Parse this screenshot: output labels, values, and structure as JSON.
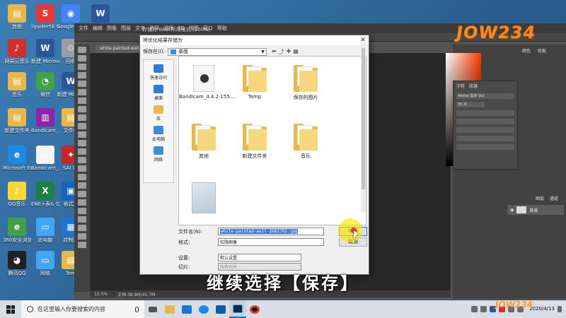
{
  "desktop_icons": [
    {
      "label": "其他",
      "color": "#e8b94a",
      "glyph": "▤"
    },
    {
      "label": "Spyder5E 5.2",
      "color": "#e53935",
      "glyph": "S"
    },
    {
      "label": "Google Chrome",
      "color": "#4285f4",
      "glyph": "◉"
    },
    {
      "label": "新建",
      "color": "#2b579a",
      "glyph": "W"
    },
    {
      "label": "网易云音乐",
      "color": "#d32f2f",
      "glyph": "♪"
    },
    {
      "label": "新建 Microsoft",
      "color": "#2b579a",
      "glyph": "W"
    },
    {
      "label": "回收",
      "color": "#9e9e9e",
      "glyph": "♲"
    },
    {
      "label": "音乐",
      "color": "#e8b94a",
      "glyph": "▤"
    },
    {
      "label": "微信",
      "color": "#43a047",
      "glyph": "◔"
    },
    {
      "label": "新建 Micros",
      "color": "#2b579a",
      "glyph": "W"
    },
    {
      "label": "新建文件夹",
      "color": "#e8b94a",
      "glyph": "▤"
    },
    {
      "label": "Bandicam_...",
      "color": "#8e24aa",
      "glyph": "▥"
    },
    {
      "label": "文件保",
      "color": "#e8b94a",
      "glyph": "▤"
    },
    {
      "label": "Microsoft Edge",
      "color": "#1e88e5",
      "glyph": "e"
    },
    {
      "label": "Bandicam_...",
      "color": "#f5f5f5",
      "glyph": "▭"
    },
    {
      "label": "SAI Vo",
      "color": "#c62828",
      "glyph": "✦"
    },
    {
      "label": "QQ音乐",
      "color": "#fdd835",
      "glyph": "♪"
    },
    {
      "label": "ENE+表& 位.xls",
      "color": "#1e7e45",
      "glyph": "X"
    },
    {
      "label": "格式工",
      "color": "#1565c0",
      "glyph": "▣"
    },
    {
      "label": "360安全浏览器",
      "color": "#43a047",
      "glyph": "e"
    },
    {
      "label": "此电脑",
      "color": "#42a5f5",
      "glyph": "▭"
    },
    {
      "label": "控制面",
      "color": "#1976d2",
      "glyph": "▦"
    },
    {
      "label": "腾讯QQ",
      "color": "#212121",
      "glyph": "◕"
    },
    {
      "label": "网络",
      "color": "#42a5f5",
      "glyph": "▭"
    },
    {
      "label": "Tem",
      "color": "#e8b94a",
      "glyph": "▤"
    }
  ],
  "ps": {
    "menu_items": [
      "文件",
      "编辑",
      "图像",
      "图层",
      "文字",
      "选择",
      "滤镜",
      "3D",
      "视图",
      "窗口",
      "帮助"
    ],
    "doc_tab": "white-painted-wall-266...",
    "status": [
      "12.5%",
      "文档:38.9M/45.7M"
    ],
    "panels": {
      "swatch_tab": "颜色",
      "swatch_tab2": "色板",
      "char_tab": "字符",
      "char_tab2": "段落",
      "font": "Adobe 黑体 Std",
      "size": "30 点",
      "layers_tab": "图层",
      "layers_tab2": "通道",
      "layer_name": "背景"
    }
  },
  "logo": "JOW234",
  "dialog": {
    "ps_title": "存储为 Web 所用格式 (100%)",
    "title": "将优化结果存储为",
    "save_in_label": "保存在(I):",
    "save_in_value": "桌面",
    "places": [
      "快速访问",
      "桌面",
      "库",
      "此电脑",
      "网络"
    ],
    "files": [
      "Bandicam_4.4.2.155...",
      "Temp",
      "保存的图片",
      "其他",
      "新建文件夹",
      "音乐",
      ""
    ],
    "filename_label": "文件名(N):",
    "filename_value": "white-painted-wall-2662792.jpg",
    "format_label": "格式:",
    "format_value": "仅限图像",
    "settings_label": "设置:",
    "settings_value": "默认设置",
    "slices_label": "切片:",
    "slices_value": "所有切片",
    "save_button": "保存",
    "cancel_button": "取消"
  },
  "caption": "继续选择【保存】",
  "taskbar": {
    "search_placeholder": "在这里输入你要搜索的内容",
    "time": "",
    "date": "2020/4/13",
    "watermark": "JOW234"
  }
}
